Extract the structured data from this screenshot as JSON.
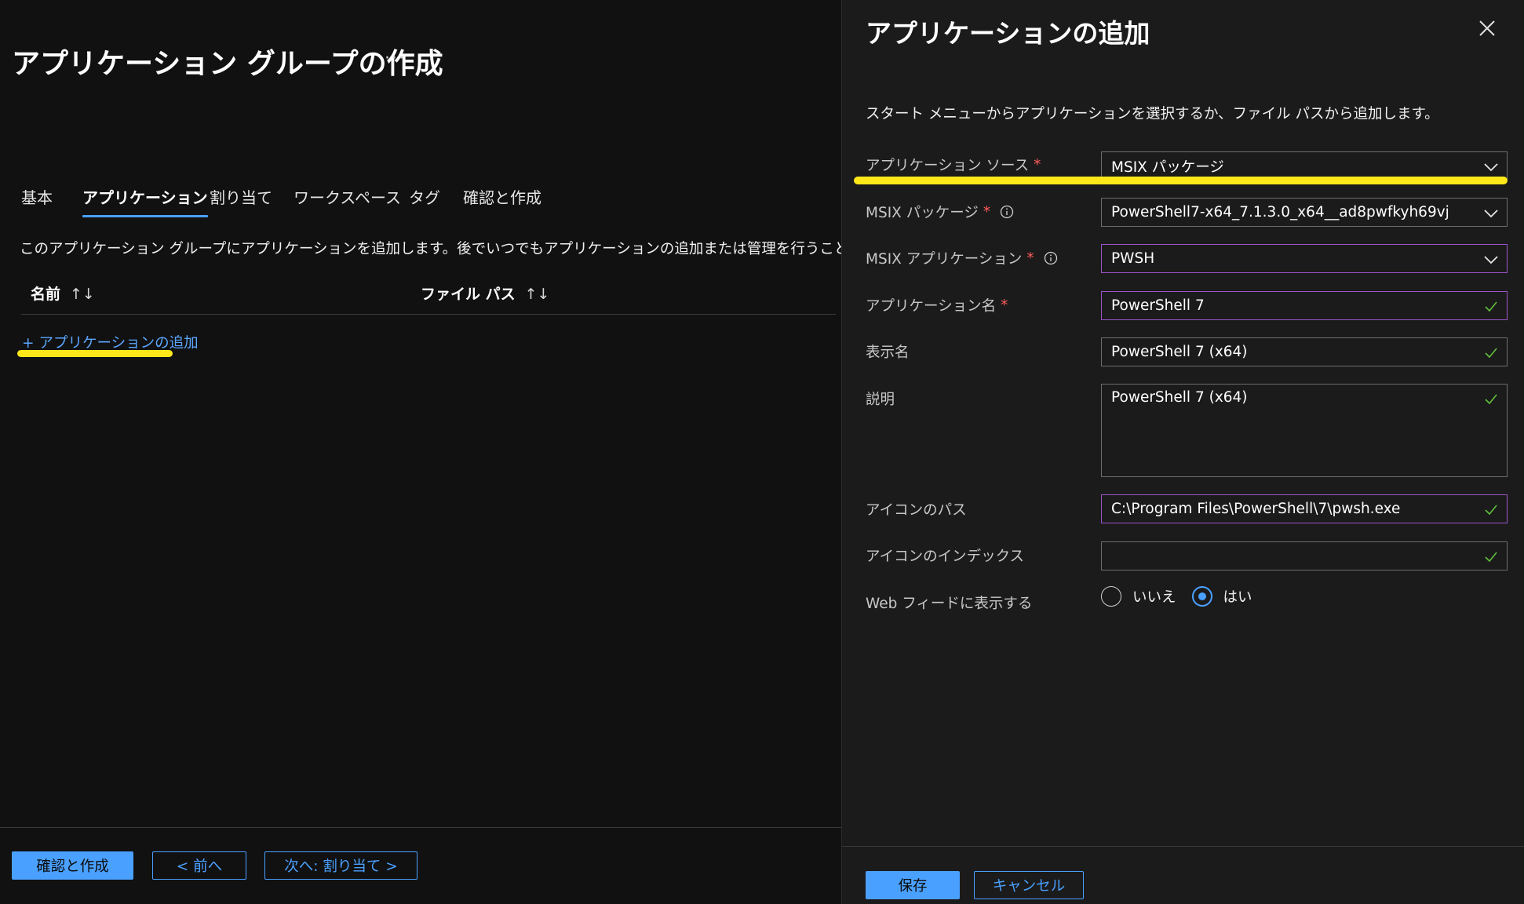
{
  "left": {
    "title": "アプリケーション グループの作成",
    "more_label": "···",
    "tabs": [
      {
        "label": "基本"
      },
      {
        "label": "アプリケーション"
      },
      {
        "label": "割り当て"
      },
      {
        "label": "ワークスペース"
      },
      {
        "label": "タグ"
      },
      {
        "label": "確認と作成"
      }
    ],
    "active_tab": "アプリケーション",
    "description": "このアプリケーション グループにアプリケーションを追加します。後でいつでもアプリケーションの追加または管理を行うことができます。",
    "table": {
      "columns": [
        {
          "label": "名前",
          "sort_icon": "↑↓"
        },
        {
          "label": "ファイル パス",
          "sort_icon": "↑↓"
        }
      ]
    },
    "add_app": {
      "plus": "+",
      "label": "アプリケーションの追加"
    },
    "footer": {
      "review_create": "確認と作成",
      "prev": "< 前へ",
      "next": "次へ: 割り当て >"
    }
  },
  "blade": {
    "title": "アプリケーションの追加",
    "description": "スタート メニューからアプリケーションを選択するか、ファイル パスから追加します。",
    "fields": {
      "app_source": {
        "label": "アプリケーション ソース",
        "required": "*",
        "value": "MSIX パッケージ"
      },
      "msix_package": {
        "label": "MSIX パッケージ",
        "required": "*",
        "value": "PowerShell7-x64_7.1.3.0_x64__ad8pwfkyh69vj"
      },
      "msix_app": {
        "label": "MSIX アプリケーション",
        "required": "*",
        "value": "PWSH"
      },
      "app_name": {
        "label": "アプリケーション名",
        "required": "*",
        "value": "PowerShell 7"
      },
      "display_name": {
        "label": "表示名",
        "value": "PowerShell 7 (x64)"
      },
      "description": {
        "label": "説明",
        "value": "PowerShell 7 (x64)"
      },
      "icon_path": {
        "label": "アイコンのパス",
        "value": "C:\\Program Files\\PowerShell\\7\\pwsh.exe"
      },
      "icon_index": {
        "label": "アイコンのインデックス",
        "value": ""
      },
      "show_in_feed": {
        "label": "Web フィードに表示する",
        "options": [
          "いいえ",
          "はい"
        ],
        "selected": "はい"
      }
    },
    "footer": {
      "save": "保存",
      "cancel": "キャンセル"
    }
  },
  "colors": {
    "accent": "#4aa0ff",
    "highlight": "#ffe81a",
    "required": "#ff5a5a",
    "valid_check": "#5fbf3a",
    "focus_border": "#9b55c8"
  },
  "icons": [
    "more-icon",
    "sort-icon",
    "close-icon",
    "chevron-down-icon",
    "info-icon",
    "checkmark-icon"
  ]
}
